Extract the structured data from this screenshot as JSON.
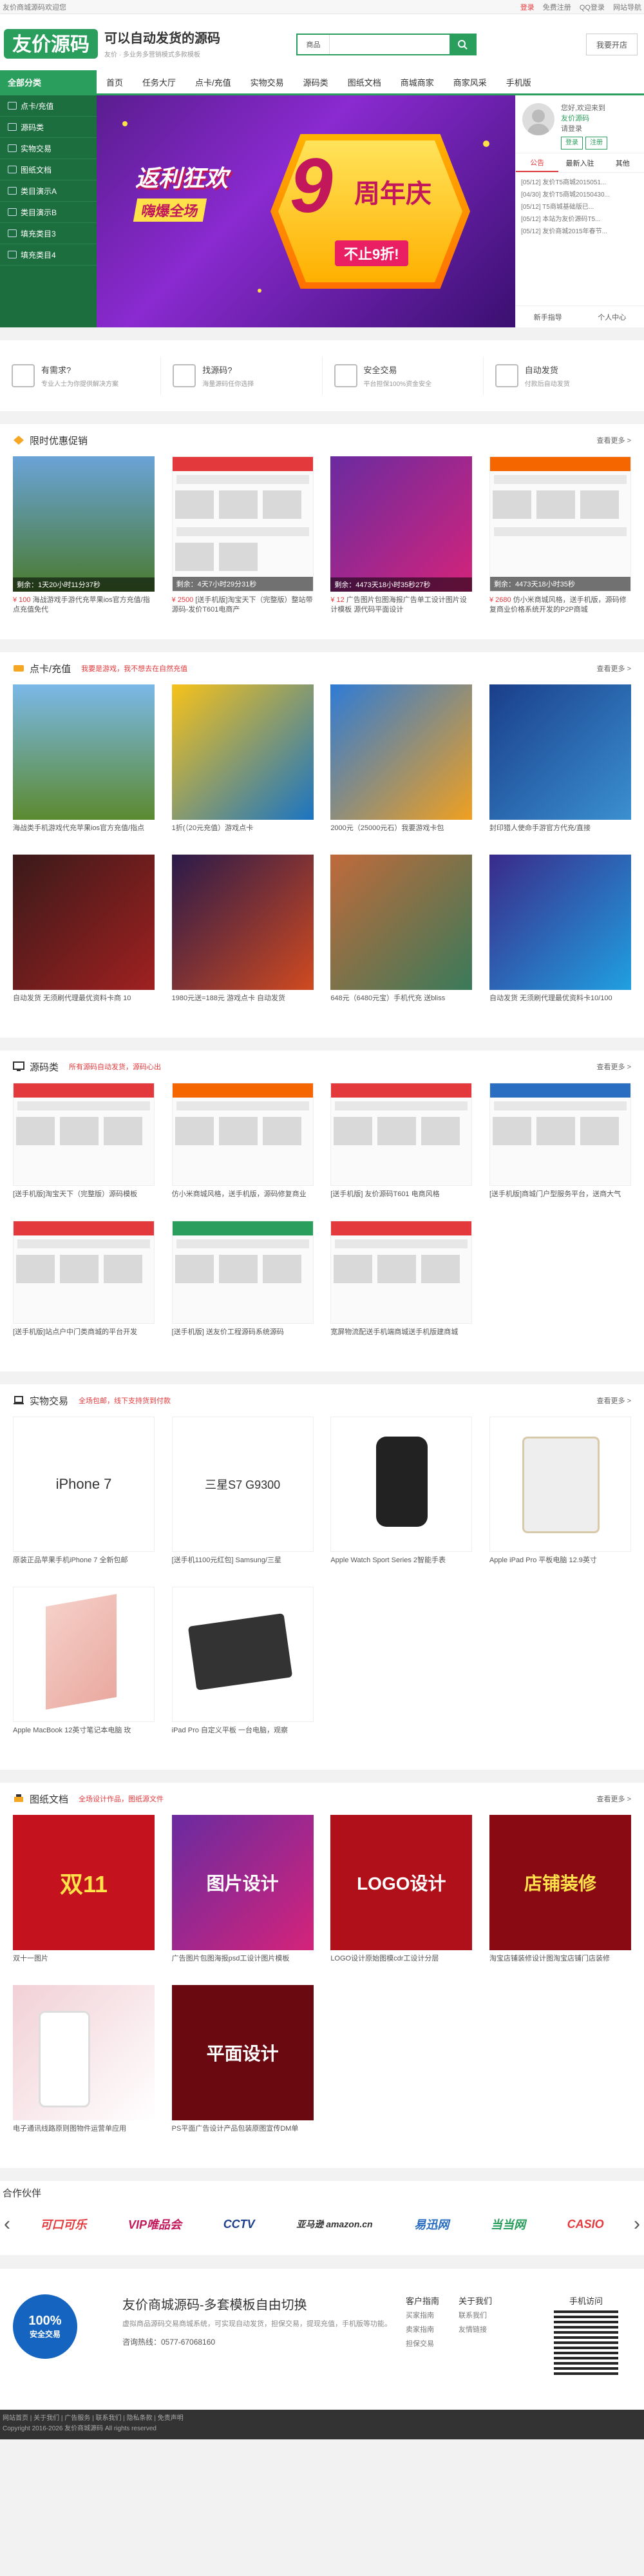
{
  "topbar": {
    "welcome": "友价商城源码欢迎您",
    "links": [
      "登录",
      "免费注册",
      "QQ登录",
      "网站导航"
    ]
  },
  "header": {
    "logo": "友价源码",
    "slogan1": "可以自动发货的源码",
    "slogan2": "友价 · 多业务多营销模式多款模板",
    "search_cat": "商品",
    "search_placeholder": "",
    "shop_btn": "我要开店"
  },
  "nav": {
    "allcat": "全部分类",
    "items": [
      "首页",
      "任务大厅",
      "点卡/充值",
      "实物交易",
      "源码类",
      "图纸文档",
      "商城商家",
      "商家风采",
      "手机版"
    ]
  },
  "catlist": [
    "点卡/充值",
    "源码类",
    "实物交易",
    "图纸文档",
    "类目演示A",
    "类目演示B",
    "填充类目3",
    "填充类目4"
  ],
  "banner": {
    "left1": "返利狂欢",
    "left2": "嗨爆全场",
    "nine": "9",
    "word": "周年庆",
    "tag": "不止9折!"
  },
  "user": {
    "hello": "您好,欢迎来到",
    "site": "友价源码",
    "q": "请登录",
    "reg": "免费注册",
    "btn1": "登录",
    "btn2": "注册"
  },
  "ptabs": [
    "公告",
    "最新入驻",
    "其他"
  ],
  "notices": [
    "[05/12] 友价T5商城2015051...",
    "[04/30] 友价T5商城20150430...",
    "[05/12] T5商城基础版已...",
    "[05/12] 本站为友价源码T5...",
    "[05/12] 友价商城2015年春节..."
  ],
  "rp_bottom": [
    "新手指导",
    "个人中心"
  ],
  "features": [
    {
      "t": "有需求?",
      "d": "专业人士为你提供解决方案"
    },
    {
      "t": "找源码?",
      "d": "海量源码任你选择"
    },
    {
      "t": "安全交易",
      "d": "平台担保100%资金安全"
    },
    {
      "t": "自动发货",
      "d": "付款后自动发货"
    }
  ],
  "sec1": {
    "title": "限时优惠促销",
    "more": "查看更多 >",
    "items": [
      {
        "ov": "剩余：1天20小时11分37秒",
        "p": "¥ 100",
        "c": "海战游戏手游代充苹果ios官方充值/指点充值免代"
      },
      {
        "ov": "剩余：4天7小时29分31秒",
        "p": "¥ 2500",
        "c": "[送手机版]淘宝天下（完整版）整站带源码-发价T601电商产"
      },
      {
        "ov": "剩余：4473天18小时35秒27秒",
        "p": "¥ 12",
        "c": "广告图片包图海报广告单工设计图片设计模板 源代码平面设计"
      },
      {
        "ov": "剩余：4473天18小时35秒",
        "p": "¥ 2680",
        "c": "仿小米商城风格，送手机版，源码修复商业价格系统开发的P2P商城"
      }
    ]
  },
  "sec2": {
    "title": "点卡/充值",
    "sub": "我要是游戏，我不想去在自然充值",
    "more": "查看更多 >",
    "items": [
      "海战类手机游戏代充苹果ios官方充值/指点",
      "1折(（20元充值）游戏点卡",
      "2000元（25000元石）我要游戏卡包",
      "封印猎人使命手游官方代充/直接",
      "自动发货 无须刷代理最优资料卡商 10",
      "1980元送=188元 游戏点卡 自动发货",
      "648元（6480元宝）手机代充 送bliss",
      "自动发货 无须刷代理最优资料卡10/100"
    ]
  },
  "sec3": {
    "title": "源码类",
    "sub": "所有源码自动发货，源码心出",
    "more": "查看更多 >",
    "items": [
      "[送手机版]淘宝天下（完整版）源码模板",
      "仿小米商城风格，送手机版，源码修复商业",
      "[送手机版] 友价源码T601 电商风格",
      "[送手机版]商城门户型服务平台，送商大气",
      "[送手机版]站点户中门类商城的平台开发",
      "[送手机版] 送友价工程源码系统源码",
      "宽屏物流配送手机端商城送手机版建商城"
    ]
  },
  "sec4": {
    "title": "实物交易",
    "sub": "全场包邮，线下支持货到付款",
    "more": "查看更多 >",
    "items": [
      {
        "c": "原装正品苹果手机iPhone 7 全新包邮",
        "pic": "iPhone 7"
      },
      {
        "c": "[送手机1100元红包] Samsung/三星",
        "pic": "三星S7 G9300"
      },
      {
        "c": "Apple Watch Sport Series 2智能手表",
        "pic": ""
      },
      {
        "c": "Apple iPad Pro 平板电脑 12.9英寸",
        "pic": ""
      },
      {
        "c": "Apple MacBook 12英寸笔记本电脑 玫",
        "pic": ""
      },
      {
        "c": "iPad Pro 自定义平板 一台电脑，观察",
        "pic": ""
      }
    ]
  },
  "sec5": {
    "title": "图纸文档",
    "sub": "全场设计作品，图纸源文件",
    "more": "查看更多 >",
    "items": [
      "双十一图片",
      "广告图片包图海报psd工设计图片模板",
      "LOGO设计原始图模cdr工设计分层",
      "淘宝店铺装修设计图淘宝店铺门店装修",
      "电子通讯线路原则图物件运营单应用",
      "PS平面广告设计产品包装原图宣传DM单"
    ],
    "labels": [
      "双11",
      "图片设计",
      "LOGO设计",
      "店铺装修",
      "平面设计"
    ]
  },
  "partners": {
    "title": "合作伙伴",
    "logos": [
      "可口可乐",
      "VIP唯品会",
      "CCTV",
      "亚马逊 amazon.cn",
      "易迅网",
      "当当网",
      "CASIO"
    ]
  },
  "footer": {
    "badge1": "100%",
    "badge2": "安全交易",
    "title": "友价商城源码-多套模板自由切换",
    "desc": "虚拟商品源码交易商城系统，可实现自动发货，担保交易，提现充值，手机版等功能。",
    "phone": "咨询热线：0577-67068160",
    "cols": [
      [
        "客户指南",
        "买家指南",
        "卖家指南",
        "担保交易"
      ],
      [
        "关于我们",
        "联系我们",
        "友情链接"
      ]
    ],
    "qr": "手机访问"
  },
  "bottom": {
    "line1": "网站首页 | 关于我们 | 广告服务 | 联系我们 | 隐私条款 | 免责声明",
    "line2": "Copyright 2016-2026 友价商城源码 All rights reserved"
  },
  "colors": {
    "green": "#2a9e5c",
    "red": "#e4393c"
  }
}
